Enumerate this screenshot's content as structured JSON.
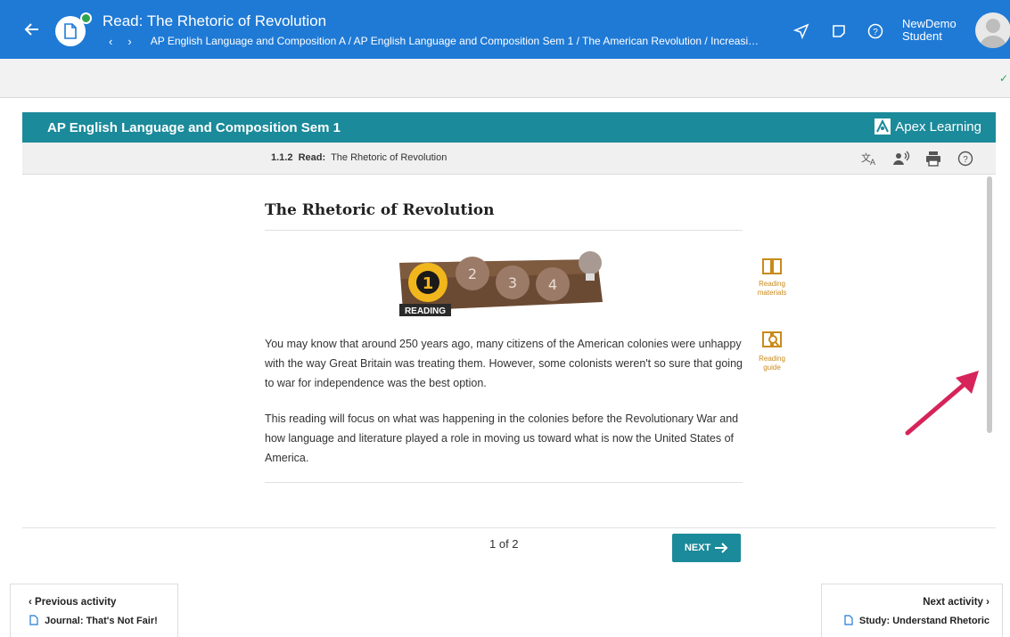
{
  "header": {
    "title": "Read: The Rhetoric of Revolution",
    "breadcrumb": "AP English Language and Composition A / AP English Language and Composition Sem 1 / The American Revolution / Increasi…",
    "user_line1": "NewDemo",
    "user_line2": "Student"
  },
  "course": {
    "name": "AP English Language and Composition Sem 1",
    "brand": "Apex Learning",
    "lesson_num": "1.1.2",
    "lesson_type": "Read:",
    "lesson_title": "The Rhetoric of Revolution"
  },
  "content": {
    "heading": "The Rhetoric of Revolution",
    "banner_label": "READING",
    "banner_steps": [
      "1",
      "2",
      "3",
      "4"
    ],
    "para1": "You may know that around 250 years ago, many citizens of the American colonies were unhappy with the way Great Britain was treating them. However, some colonists weren't so sure that going to war for independence was the best option.",
    "para2": "This reading will focus on what was happening in the colonies before the Revolutionary War and how language and literature played a role in moving us toward what is now the United States of America."
  },
  "side_tools": {
    "reading_materials": "Reading materials",
    "reading_guide": "Reading guide"
  },
  "pager": {
    "page_info": "1 of 2",
    "next_label": "NEXT"
  },
  "activities": {
    "prev_head": "Previous activity",
    "prev_title": "Journal: That's Not Fair!",
    "next_head": "Next activity",
    "next_title": "Study: Understand Rhetoric"
  },
  "colors": {
    "topbar": "#1f7ad6",
    "coursebar": "#1b8a9a",
    "tool_orange": "#c98a1b",
    "annotation_arrow": "#d6245a"
  }
}
